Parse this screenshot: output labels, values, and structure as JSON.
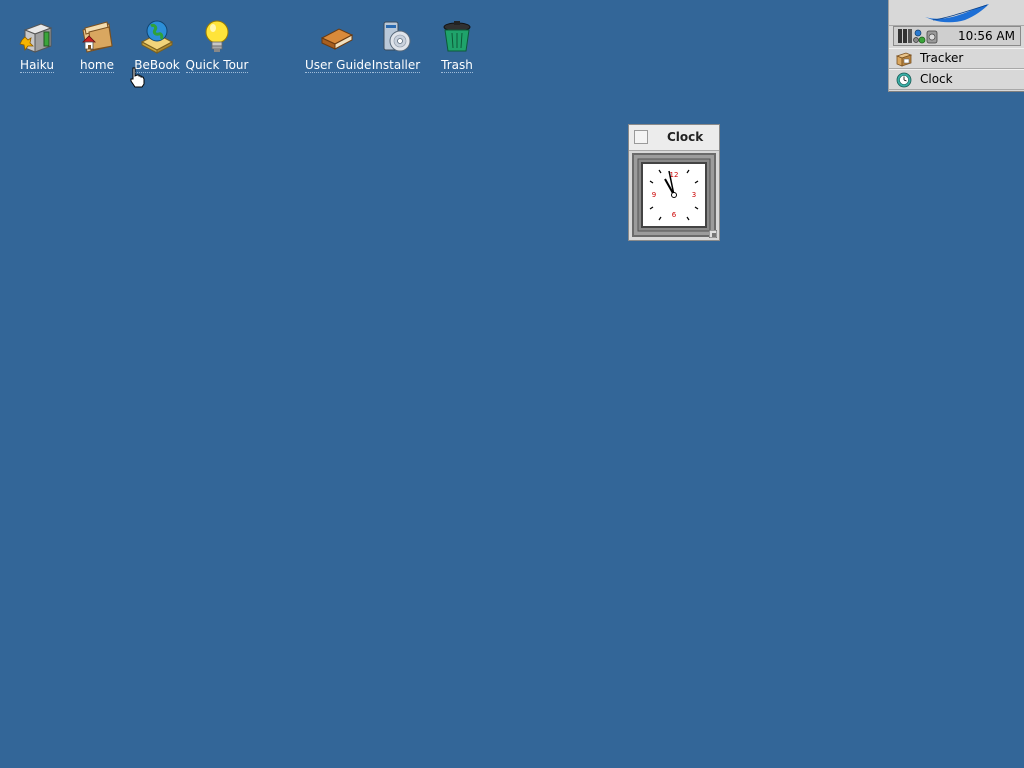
{
  "desktop": {
    "background": "#336698",
    "icons": [
      {
        "name": "desktop-icon-haiku",
        "label": "Haiku",
        "icon": "disk-icon"
      },
      {
        "name": "desktop-icon-home",
        "label": "home",
        "icon": "home-folder-icon"
      },
      {
        "name": "desktop-icon-bebook",
        "label": "BeBook",
        "icon": "bebook-icon"
      },
      {
        "name": "desktop-icon-quick-tour",
        "label": "Quick Tour",
        "icon": "lightbulb-icon"
      },
      {
        "name": "desktop-icon-user-guide",
        "label": "User Guide",
        "icon": "book-icon"
      },
      {
        "name": "desktop-icon-installer",
        "label": "Installer",
        "icon": "installer-icon"
      },
      {
        "name": "desktop-icon-trash",
        "label": "Trash",
        "icon": "trash-icon"
      }
    ]
  },
  "deskbar": {
    "time": "10:56 AM",
    "items": [
      {
        "label": "Tracker",
        "icon": "tracker-icon"
      },
      {
        "label": "Clock",
        "icon": "clock-app-icon"
      }
    ]
  },
  "clock_window": {
    "title": "Clock",
    "face_numbers": [
      "12",
      "3",
      "6",
      "9"
    ]
  },
  "colors": {
    "desktop": "#336698",
    "deskbar": "#d8d8d8",
    "leaf": "#1d6fd6",
    "clock_numbers": "#cc0000"
  }
}
